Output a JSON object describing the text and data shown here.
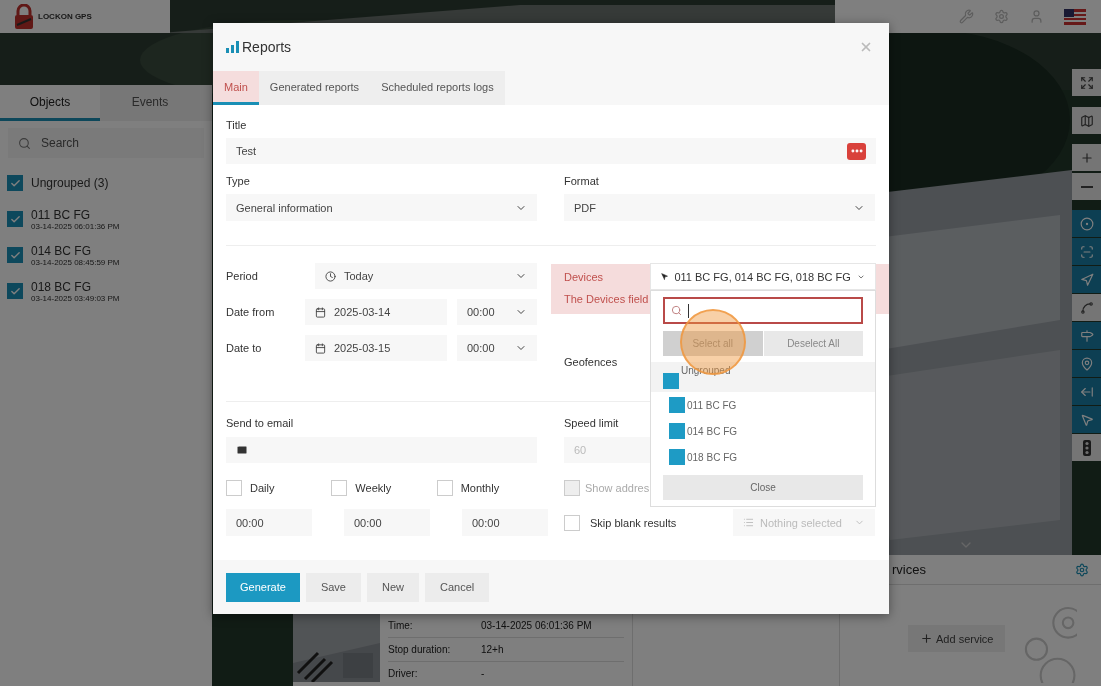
{
  "header": {
    "logo_text": "LOCKON GPS"
  },
  "sidebar": {
    "tabs": [
      {
        "label": "Objects",
        "selected": true
      },
      {
        "label": "Events",
        "selected": false
      }
    ],
    "search": {
      "placeholder": "Search"
    },
    "groups": [
      {
        "label": "Ungrouped (3)",
        "checked": true,
        "children": [
          {
            "name": "011 BC FG",
            "time": "03-14-2025 06:01:36 PM",
            "checked": true
          },
          {
            "name": "014 BC FG",
            "time": "03-14-2025 08:45:59 PM",
            "checked": true
          },
          {
            "name": "018 BC FG",
            "time": "03-14-2025 03:49:03 PM",
            "checked": true
          }
        ]
      }
    ]
  },
  "map_tools": [
    {
      "on": false
    },
    {
      "on": false
    },
    {
      "on": false
    },
    {
      "on": false
    },
    {
      "on": true
    },
    {
      "on": true
    },
    {
      "on": true
    },
    {
      "on": false
    },
    {
      "on": true
    },
    {
      "on": true
    },
    {
      "on": true
    },
    {
      "on": true
    },
    {
      "on": false
    }
  ],
  "object_details": [
    {
      "label": "Time:",
      "value": "03-14-2025 06:01:36 PM"
    },
    {
      "label": "Stop duration:",
      "value": "12+h"
    },
    {
      "label": "Driver:",
      "value": "-"
    }
  ],
  "services": {
    "title": "rvices",
    "button": "Add service"
  },
  "reports_dialog": {
    "title": "Reports",
    "tabs": [
      {
        "label": "Main",
        "selected": true
      },
      {
        "label": "Generated reports",
        "selected": false
      },
      {
        "label": "Scheduled reports logs",
        "selected": false
      }
    ],
    "title_field": {
      "label": "Title",
      "value": "Test"
    },
    "type": {
      "label": "Type",
      "value": "General information"
    },
    "format": {
      "label": "Format",
      "value": "PDF"
    },
    "period": {
      "label": "Period",
      "value": "Today"
    },
    "date_from": {
      "label": "Date from",
      "date": "2025-03-14",
      "time": "00:00"
    },
    "date_to": {
      "label": "Date to",
      "date": "2025-03-15",
      "time": "00:00"
    },
    "devices": {
      "label": "Devices",
      "error": "The Devices field",
      "value": "011 BC FG, 014 BC FG, 018 BC FG",
      "expanded": true
    },
    "geofences": {
      "label": "Geofences"
    },
    "send_to_email": {
      "label": "Send to email"
    },
    "speed_limit": {
      "label": "Speed limit",
      "value": "60",
      "disabled": true
    },
    "schedules": [
      {
        "label": "Daily",
        "checked": false,
        "time": "00:00"
      },
      {
        "label": "Weekly",
        "checked": false,
        "time": "00:00"
      },
      {
        "label": "Monthly",
        "checked": false,
        "time": "00:00"
      }
    ],
    "show_address": {
      "label": "Show addres",
      "checked": false,
      "disabled": true
    },
    "skip_blank_results": {
      "label": "Skip blank results",
      "checked": false
    },
    "stops_select": {
      "placeholder": "Nothing selected",
      "disabled": true
    },
    "buttons": [
      {
        "label": "Generate",
        "kind": "primary"
      },
      {
        "label": "Save",
        "kind": "default"
      },
      {
        "label": "New",
        "kind": "default"
      },
      {
        "label": "Cancel",
        "kind": "default"
      }
    ]
  },
  "device_dropdown": {
    "select_all": "Select all",
    "deselect_all": "Deselect All",
    "groups": [
      {
        "label": "Ungrouped",
        "checked": true,
        "children": [
          {
            "label": "011 BC FG",
            "checked": true
          },
          {
            "label": "014 BC FG",
            "checked": true
          },
          {
            "label": "018 BC FG",
            "checked": true
          }
        ]
      }
    ],
    "close": "Close"
  }
}
